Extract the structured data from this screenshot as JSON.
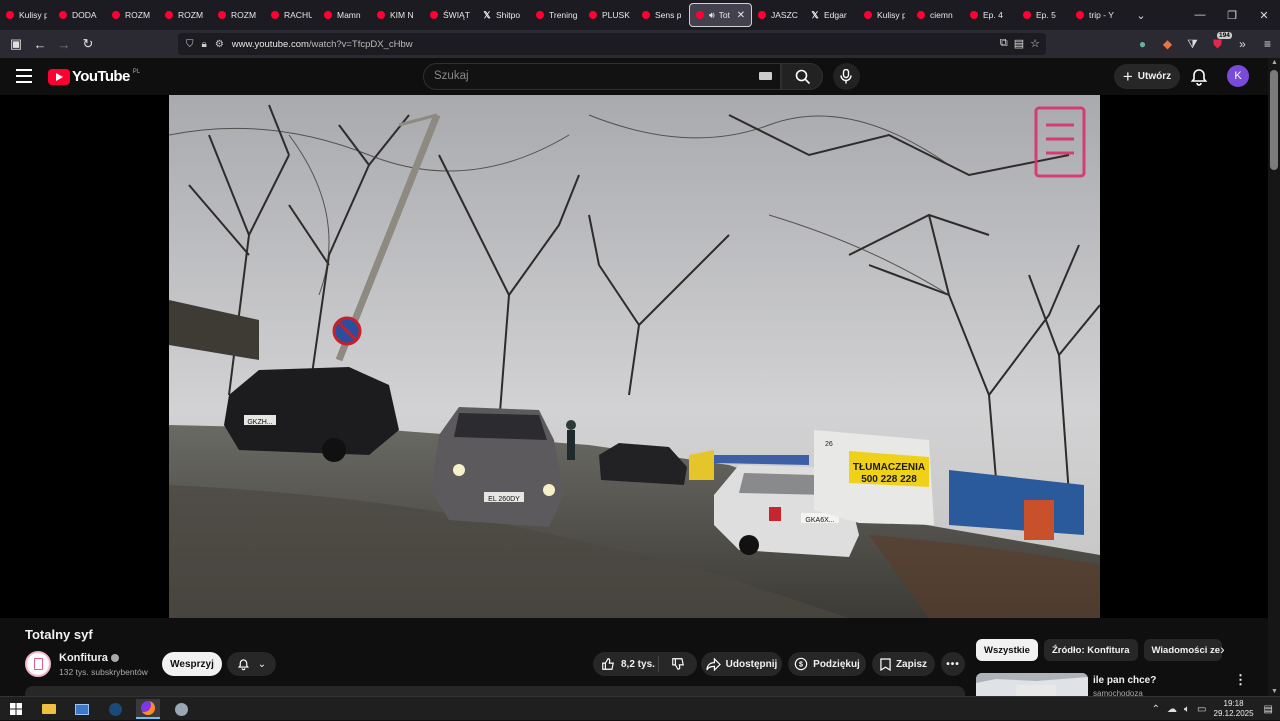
{
  "browser": {
    "tabs": [
      {
        "label": "Kulisy p",
        "icon": "youtube"
      },
      {
        "label": "DODA",
        "icon": "youtube"
      },
      {
        "label": "ROZM",
        "icon": "youtube"
      },
      {
        "label": "ROZM",
        "icon": "youtube"
      },
      {
        "label": "ROZM",
        "icon": "youtube"
      },
      {
        "label": "RACHU",
        "icon": "youtube"
      },
      {
        "label": "Mamn",
        "icon": "youtube"
      },
      {
        "label": "KIM N",
        "icon": "youtube"
      },
      {
        "label": "ŚWIĄT",
        "icon": "youtube"
      },
      {
        "label": "Shitpo",
        "icon": "x"
      },
      {
        "label": "Trening",
        "icon": "youtube"
      },
      {
        "label": "PLUSK",
        "icon": "youtube"
      },
      {
        "label": "Sens p",
        "icon": "youtube"
      },
      {
        "label": "Tot",
        "icon": "youtube",
        "active": true
      },
      {
        "label": "JASZC",
        "icon": "youtube"
      },
      {
        "label": "Edgar",
        "icon": "x"
      },
      {
        "label": "Kulisy p",
        "icon": "youtube"
      },
      {
        "label": "ciemn",
        "icon": "youtube"
      },
      {
        "label": "Ep. 4",
        "icon": "youtube"
      },
      {
        "label": "Ep. 5",
        "icon": "youtube"
      },
      {
        "label": "trip - Y",
        "icon": "youtube"
      }
    ],
    "url_host": "www.youtube.com",
    "url_path": "/watch?v=TfcpDX_cHbw",
    "extension_badge": "194"
  },
  "youtube": {
    "logo_text": "YouTube",
    "country_code": "PL",
    "search_placeholder": "Szukaj",
    "create_label": "Utwórz",
    "avatar_letter": "K"
  },
  "video": {
    "title": "Totalny syf",
    "channel_name": "Konfitura",
    "subscribers": "132 tys. subskrybentów",
    "join_label": "Wesprzyj",
    "likes": "8,2 tys.",
    "share_label": "Udostępnij",
    "thanks_label": "Podziękuj",
    "save_label": "Zapisz",
    "scene_texts": {
      "sign_line1": "TŁUMACZENIA",
      "sign_line2": "500 228 228",
      "plate_1": "GKZH...",
      "plate_2": "EL 260DY",
      "plate_3": "GKA6X...",
      "cabin_number": "26"
    }
  },
  "sidebar": {
    "chips": [
      {
        "label": "Wszystkie",
        "selected": true
      },
      {
        "label": "Źródło: Konfitura",
        "selected": false
      },
      {
        "label": "Wiadomości ze",
        "selected": false
      }
    ],
    "recommendation": {
      "title": "ile pan chce?",
      "channel": "samochodoza"
    }
  },
  "taskbar": {
    "time": "19:18",
    "date": "29.12.2025"
  },
  "colors": {
    "yt_red": "#ff0033",
    "avatar_purple": "#7a4ad8",
    "background": "#0f0f0f"
  }
}
